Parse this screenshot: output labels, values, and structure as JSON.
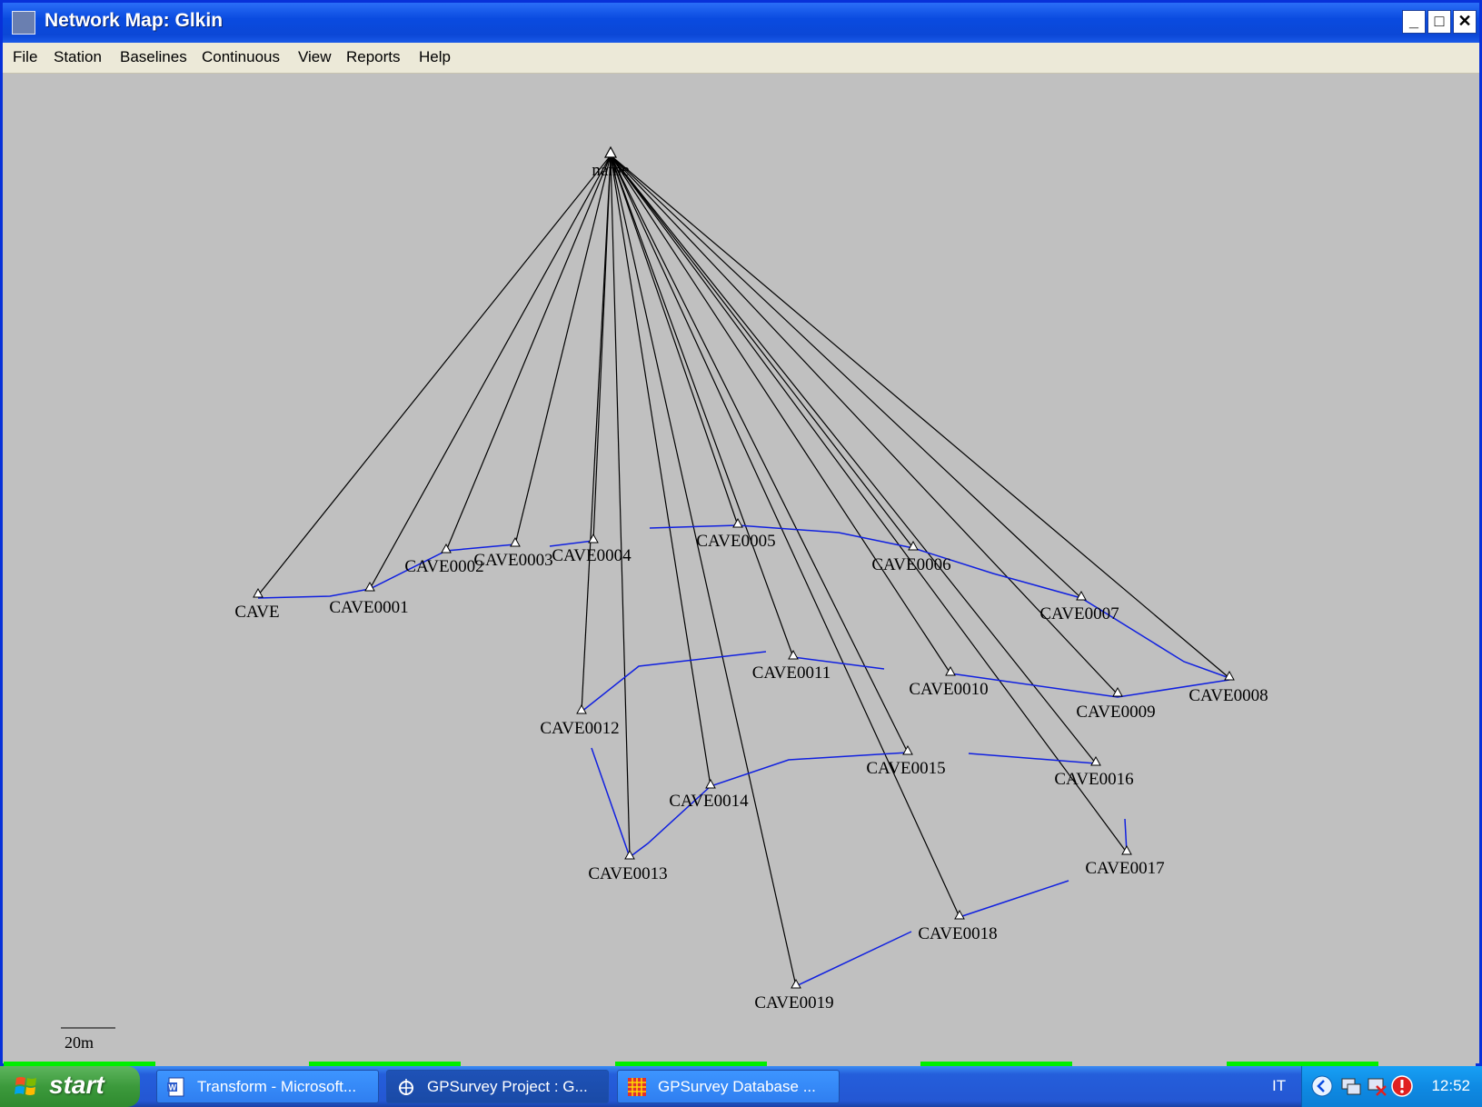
{
  "window": {
    "title": "Network Map: Glkin"
  },
  "menu": [
    "File",
    "Station",
    "Baselines",
    "Continuous",
    "View",
    "Reports",
    "Help"
  ],
  "map": {
    "center_label": "name",
    "scale_label": "20m",
    "stations": [
      "CAVE",
      "CAVE0001",
      "CAVE0002",
      "CAVE0003",
      "CAVE0004",
      "CAVE0005",
      "CAVE0006",
      "CAVE0007",
      "CAVE0008",
      "CAVE0009",
      "CAVE0010",
      "CAVE0011",
      "CAVE0012",
      "CAVE0013",
      "CAVE0014",
      "CAVE0015",
      "CAVE0016",
      "CAVE0017",
      "CAVE0018",
      "CAVE0019"
    ],
    "colors": {
      "baseline": "#000000",
      "continuous": "#1020e0"
    }
  },
  "taskbar": {
    "start_label": "start",
    "tasks": [
      "Transform - Microsoft...",
      "GPSurvey Project : G...",
      "GPSurvey Database ..."
    ],
    "language": "IT",
    "clock": "12:52"
  }
}
